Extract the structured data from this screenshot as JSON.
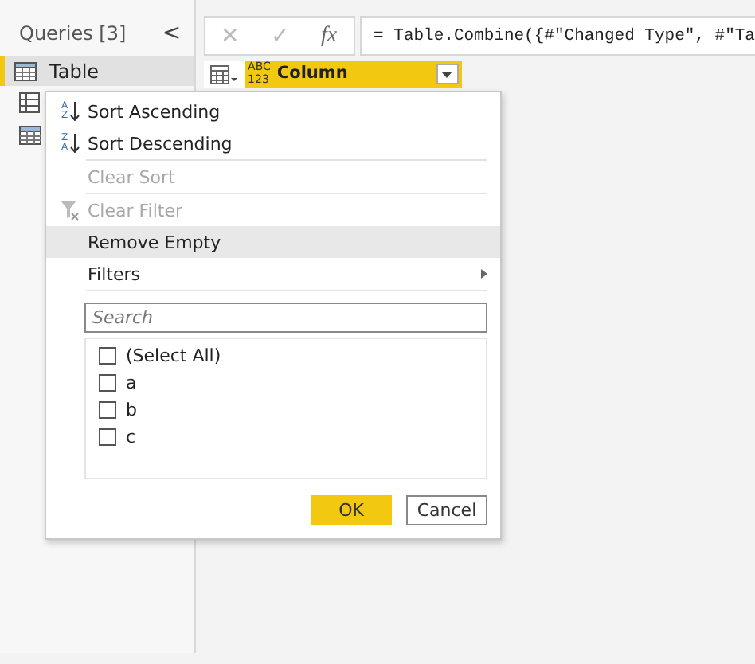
{
  "queries_pane": {
    "title": "Queries [3]",
    "collapse": "<",
    "items": [
      {
        "kind": "table",
        "name": "Table",
        "selected": true
      },
      {
        "kind": "grid",
        "selected": false
      },
      {
        "kind": "table",
        "selected": false
      }
    ]
  },
  "formula_bar": {
    "cancel": "✕",
    "confirm": "✓",
    "fx": "fx",
    "formula": "= Table.Combine({#\"Changed Type\", #\"Ta"
  },
  "column_header": {
    "type_label": "ABC\n123",
    "name": "Column"
  },
  "filter_menu": {
    "items": [
      {
        "kind": "sort",
        "glyphs": [
          "A",
          "Z"
        ],
        "label": "Sort Ascending",
        "disabled": false,
        "highlighted": false
      },
      {
        "kind": "sort",
        "glyphs": [
          "Z",
          "A"
        ],
        "label": "Sort Descending",
        "disabled": false,
        "highlighted": false
      },
      {
        "kind": "separator"
      },
      {
        "kind": "item",
        "label": "Clear Sort",
        "disabled": true,
        "highlighted": false
      },
      {
        "kind": "separator"
      },
      {
        "kind": "clear-filter",
        "label": "Clear Filter",
        "disabled": true,
        "highlighted": false
      },
      {
        "kind": "item",
        "label": "Remove Empty",
        "disabled": false,
        "highlighted": true
      },
      {
        "kind": "submenu",
        "label": "Filters",
        "disabled": false,
        "highlighted": false
      },
      {
        "kind": "separator"
      }
    ],
    "search": {
      "placeholder": "Search"
    },
    "values": [
      {
        "label": "(Select All)",
        "checked": false
      },
      {
        "label": "a",
        "checked": false
      },
      {
        "label": "b",
        "checked": false
      },
      {
        "label": "c",
        "checked": false
      }
    ],
    "buttons": [
      {
        "kind": "primary",
        "label": "OK"
      },
      {
        "kind": "secondary",
        "label": "Cancel"
      }
    ]
  }
}
